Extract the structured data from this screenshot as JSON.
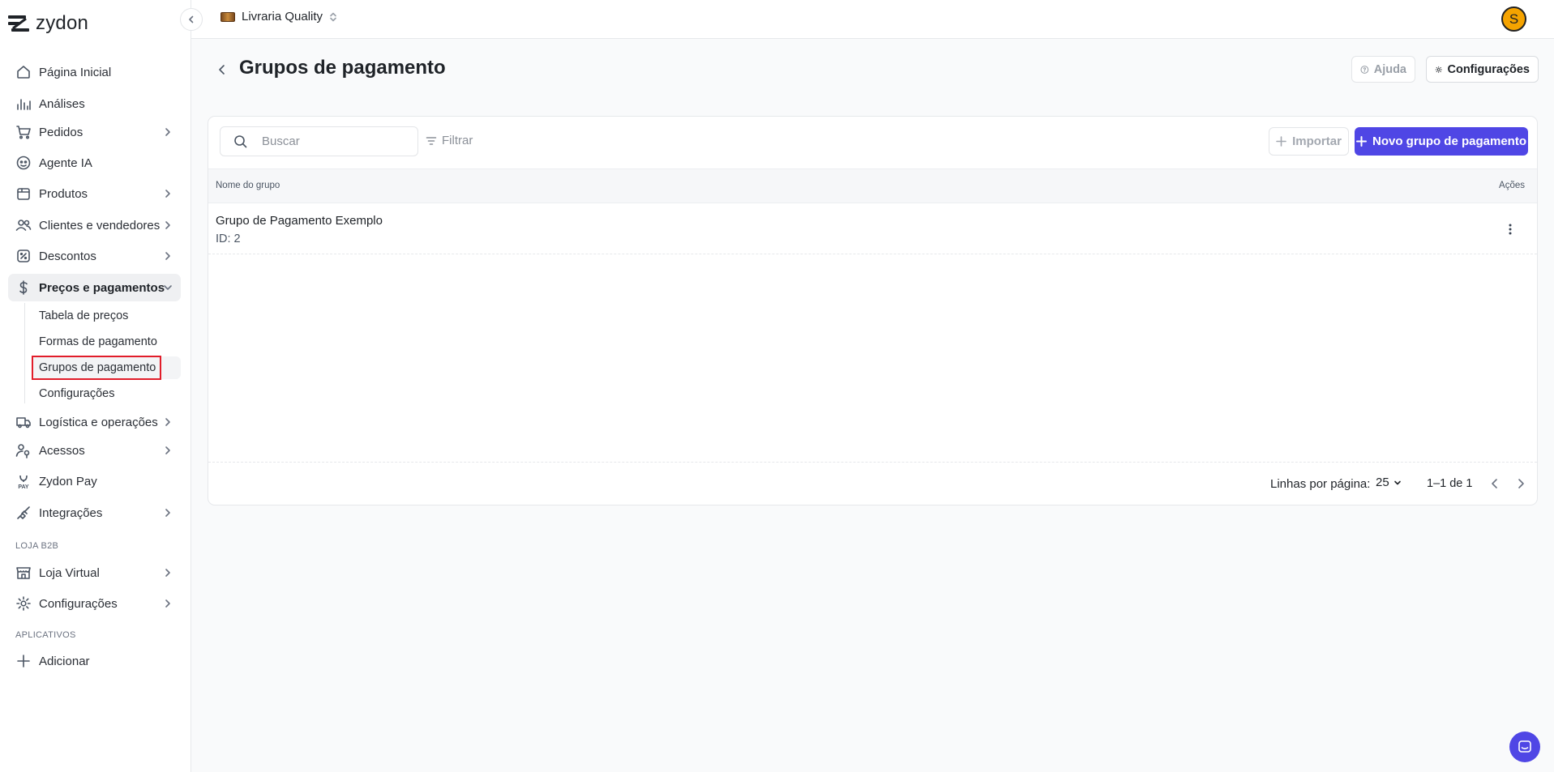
{
  "app": {
    "logo_text": "zydon"
  },
  "topbar": {
    "store_name": "Livraria Quality",
    "avatar_initial": "S",
    "avatar_color": "#f5a300"
  },
  "sidebar": {
    "items": [
      {
        "label": "Página Inicial",
        "icon": "home-icon"
      },
      {
        "label": "Análises",
        "icon": "bar-chart-icon"
      },
      {
        "label": "Pedidos",
        "icon": "cart-icon"
      },
      {
        "label": "Agente IA",
        "icon": "bot-icon"
      },
      {
        "label": "Produtos",
        "icon": "box-icon"
      },
      {
        "label": "Clientes e vendedores",
        "icon": "users-icon"
      },
      {
        "label": "Descontos",
        "icon": "discount-icon"
      },
      {
        "label": "Preços e pagamentos",
        "icon": "dollar-icon"
      },
      {
        "label": "Logística e operações",
        "icon": "truck-icon"
      },
      {
        "label": "Acessos",
        "icon": "user-key-icon"
      },
      {
        "label": "Zydon Pay",
        "icon": "pay-icon"
      },
      {
        "label": "Integrações",
        "icon": "plug-icon"
      },
      {
        "label": "Loja Virtual",
        "icon": "store-icon"
      },
      {
        "label": "Configurações",
        "icon": "gear-icon"
      },
      {
        "label": "Adicionar",
        "icon": "plus-icon"
      }
    ],
    "subitems": [
      "Tabela de preços",
      "Formas de pagamento",
      "Grupos de pagamento",
      "Configurações"
    ],
    "sections": {
      "b2b": "LOJA B2B",
      "apps": "APLICATIVOS"
    }
  },
  "header": {
    "title": "Grupos de pagamento",
    "help_label": "Ajuda",
    "config_label": "Configurações"
  },
  "toolbar": {
    "search_placeholder": "Buscar",
    "filter_label": "Filtrar",
    "import_label": "Importar",
    "new_label": "Novo grupo de pagamento",
    "accent": "#4f46e5"
  },
  "table": {
    "columns": [
      "Nome do grupo",
      "Ações"
    ],
    "rows": [
      {
        "name": "Grupo de Pagamento Exemplo",
        "id": "ID: 2"
      }
    ]
  },
  "pagination": {
    "rows_label": "Linhas por página:",
    "rows_value": "25",
    "range": "1–1 de 1"
  }
}
